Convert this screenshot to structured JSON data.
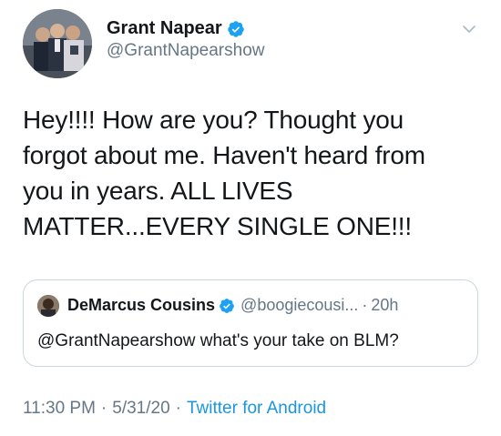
{
  "author": {
    "display_name": "Grant Napear",
    "handle": "@GrantNapearshow",
    "verified": true
  },
  "tweet": {
    "lines": [
      "Hey!!!! How are you? Thought you",
      "forgot about me.  Haven't heard from",
      "you in years. ALL LIVES",
      "MATTER...EVERY SINGLE ONE!!!"
    ]
  },
  "quoted_tweet": {
    "display_name": "DeMarcus Cousins",
    "handle": "@boogiecousi...",
    "separator": "·",
    "time": "20h",
    "text": "@GrantNapearshow what's your take on BLM?",
    "verified": true
  },
  "meta": {
    "time": "11:30 PM",
    "date": "5/31/20",
    "dot": "·",
    "source": "Twitter for Android"
  },
  "icons": {
    "verified": "verified-badge-icon",
    "caret": "chevron-down-icon"
  },
  "colors": {
    "text_primary": "#14171a",
    "text_secondary": "#657786",
    "link": "#1b95e0",
    "verified": "#1da1f2",
    "border": "#ccd6dd"
  }
}
